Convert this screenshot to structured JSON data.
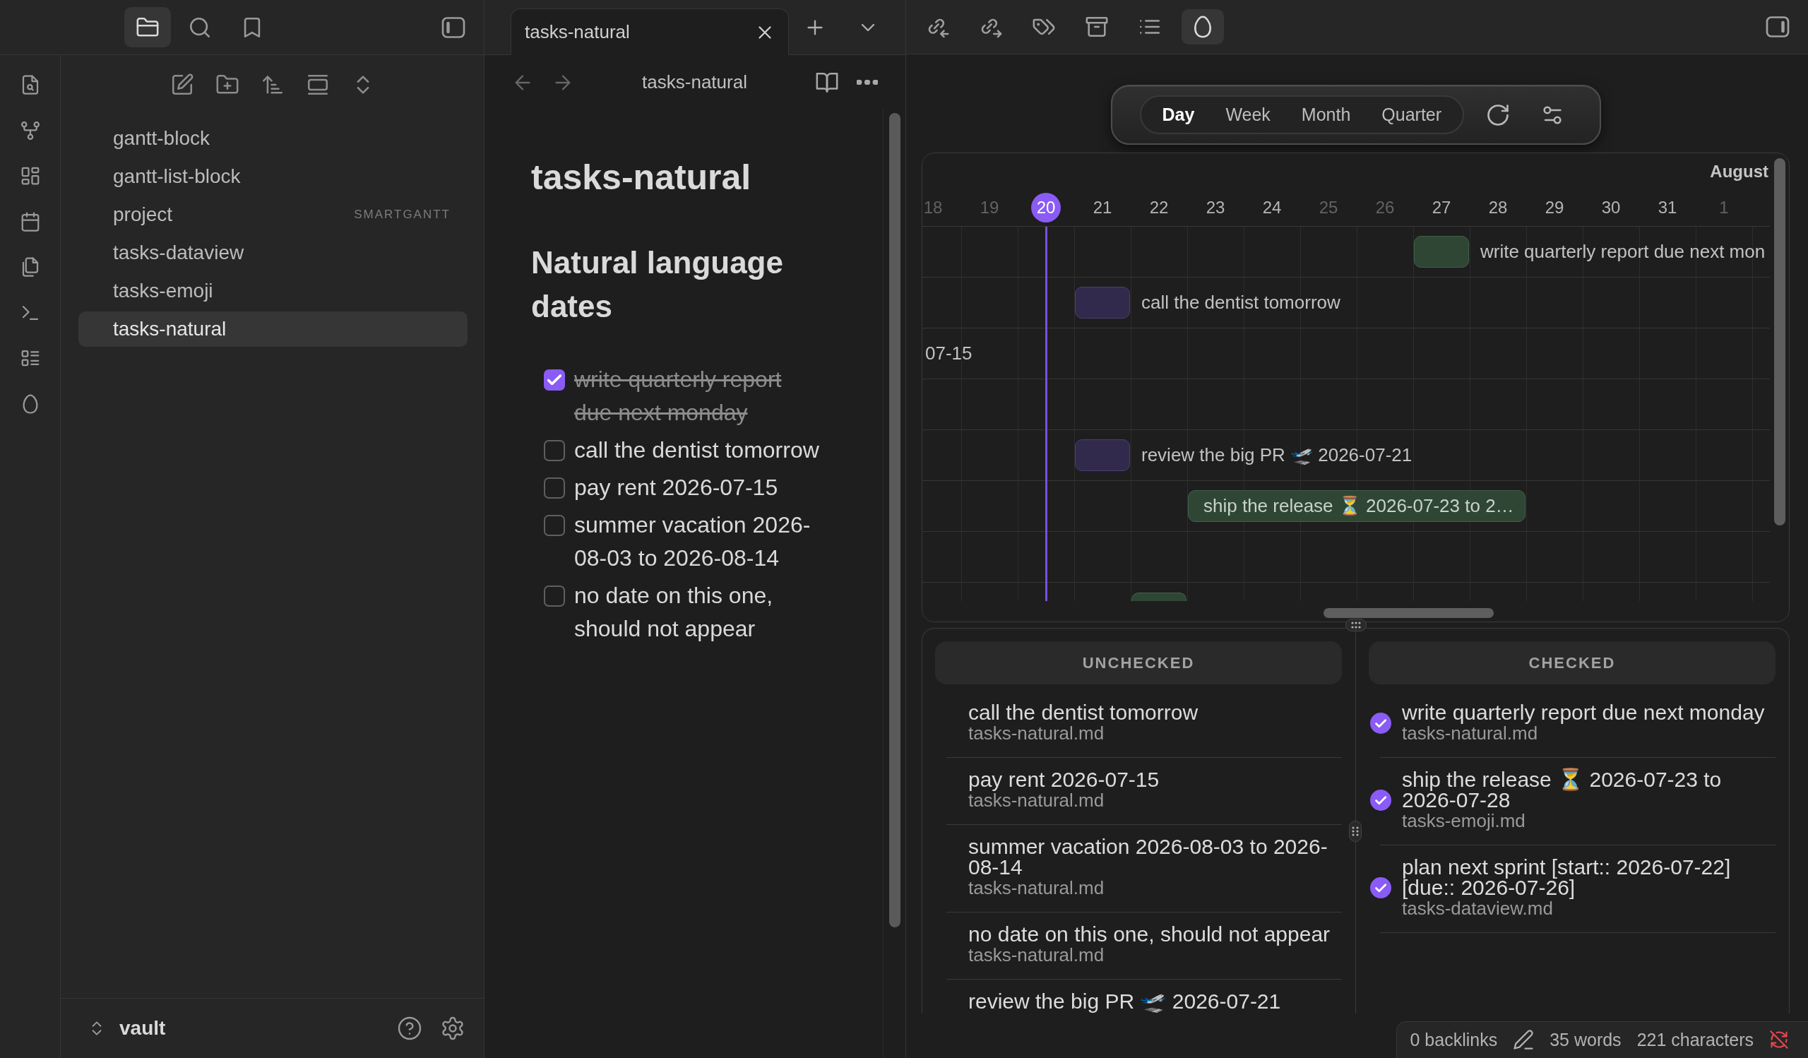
{
  "left_sidebar": {
    "tabs": [
      {
        "selected": true
      },
      {
        "selected": false
      },
      {
        "selected": false
      }
    ],
    "files": [
      {
        "name": "gantt-block",
        "selected": false
      },
      {
        "name": "gantt-list-block",
        "selected": false
      },
      {
        "name": "project",
        "tag": "SMARTGANTT",
        "selected": false
      },
      {
        "name": "tasks-dataview",
        "selected": false
      },
      {
        "name": "tasks-emoji",
        "selected": false
      },
      {
        "name": "tasks-natural",
        "selected": true
      }
    ],
    "vault": "vault"
  },
  "editor": {
    "tab_title": "tasks-natural",
    "view_title": "tasks-natural",
    "title": "tasks-natural",
    "heading": "Natural language dates",
    "tasks": [
      {
        "text": "write quarterly report due next monday",
        "checked": true
      },
      {
        "text": "call the dentist tomorrow",
        "checked": false
      },
      {
        "text": "pay rent 2026-07-15",
        "checked": false
      },
      {
        "text": "summer vacation 2026-08-03 to 2026-08-14",
        "checked": false
      },
      {
        "text": "no date on this one, should not appear",
        "checked": false
      }
    ]
  },
  "right_pane": {
    "toolbar": [
      {
        "selected": false
      },
      {
        "selected": false
      },
      {
        "selected": false
      },
      {
        "selected": false
      },
      {
        "selected": false
      },
      {
        "selected": true
      }
    ],
    "gantt": {
      "views": [
        {
          "label": "Day",
          "selected": true
        },
        {
          "label": "Week",
          "selected": false
        },
        {
          "label": "Month",
          "selected": false
        },
        {
          "label": "Quarter",
          "selected": false
        }
      ],
      "month": "August",
      "days": [
        {
          "label": "18",
          "weekend": true,
          "today": false
        },
        {
          "label": "19",
          "weekend": true,
          "today": false
        },
        {
          "label": "20",
          "weekend": false,
          "today": true
        },
        {
          "label": "21",
          "weekend": false,
          "today": false
        },
        {
          "label": "22",
          "weekend": false,
          "today": false
        },
        {
          "label": "23",
          "weekend": false,
          "today": false
        },
        {
          "label": "24",
          "weekend": false,
          "today": false
        },
        {
          "label": "25",
          "weekend": true,
          "today": false
        },
        {
          "label": "26",
          "weekend": true,
          "today": false
        },
        {
          "label": "27",
          "weekend": false,
          "today": false
        },
        {
          "label": "28",
          "weekend": false,
          "today": false
        },
        {
          "label": "29",
          "weekend": false,
          "today": false
        },
        {
          "label": "30",
          "weekend": false,
          "today": false
        },
        {
          "label": "31",
          "weekend": false,
          "today": false
        },
        {
          "label": "1",
          "weekend": true,
          "today": false
        }
      ],
      "rows": [
        {
          "kind": "bar",
          "label": "write quarterly report due next mon",
          "checked": true,
          "cells": [
            {
              "kind": "none"
            },
            {
              "kind": "none"
            },
            {
              "kind": "none"
            },
            {
              "kind": "none"
            },
            {
              "kind": "none"
            },
            {
              "kind": "none"
            },
            {
              "kind": "none"
            },
            {
              "kind": "none"
            },
            {
              "kind": "none"
            },
            {
              "kind": "bar"
            },
            {
              "kind": "none"
            },
            {
              "kind": "none"
            },
            {
              "kind": "none"
            },
            {
              "kind": "none"
            },
            {
              "kind": "none"
            }
          ]
        },
        {
          "kind": "bar",
          "label": "call the dentist tomorrow",
          "checked": false,
          "cells": [
            {
              "kind": "none"
            },
            {
              "kind": "none"
            },
            {
              "kind": "none"
            },
            {
              "kind": "bar"
            },
            {
              "kind": "none"
            },
            {
              "kind": "none"
            },
            {
              "kind": "none"
            },
            {
              "kind": "none"
            },
            {
              "kind": "none"
            },
            {
              "kind": "none"
            },
            {
              "kind": "none"
            },
            {
              "kind": "none"
            },
            {
              "kind": "none"
            },
            {
              "kind": "none"
            },
            {
              "kind": "none"
            }
          ]
        },
        {
          "kind": "label_only",
          "label": "07-15"
        },
        {
          "kind": "empty"
        },
        {
          "kind": "bar",
          "label": "review the big PR 🛫 2026-07-21",
          "checked": false,
          "cells": [
            {
              "kind": "none"
            },
            {
              "kind": "none"
            },
            {
              "kind": "none"
            },
            {
              "kind": "bar"
            },
            {
              "kind": "none"
            },
            {
              "kind": "none"
            },
            {
              "kind": "none"
            },
            {
              "kind": "none"
            },
            {
              "kind": "none"
            },
            {
              "kind": "none"
            },
            {
              "kind": "none"
            },
            {
              "kind": "none"
            },
            {
              "kind": "none"
            },
            {
              "kind": "none"
            },
            {
              "kind": "none"
            }
          ]
        },
        {
          "kind": "bar",
          "label": "ship the release ⏳ 2026-07-23 to 2…",
          "checked": true,
          "cells": [
            {
              "kind": "none"
            },
            {
              "kind": "none"
            },
            {
              "kind": "none"
            },
            {
              "kind": "none"
            },
            {
              "kind": "none"
            },
            {
              "kind": "bar"
            },
            {
              "kind": "bar"
            },
            {
              "kind": "bar"
            },
            {
              "kind": "bar"
            },
            {
              "kind": "bar"
            },
            {
              "kind": "bar"
            },
            {
              "kind": "none"
            },
            {
              "kind": "none"
            },
            {
              "kind": "none"
            },
            {
              "kind": "none"
            }
          ]
        },
        {
          "kind": "empty"
        },
        {
          "kind": "bar",
          "checked": true,
          "cells": [
            {
              "kind": "none"
            },
            {
              "kind": "none"
            },
            {
              "kind": "none"
            },
            {
              "kind": "none"
            },
            {
              "kind": "bar"
            },
            {
              "kind": "none"
            },
            {
              "kind": "none"
            },
            {
              "kind": "none"
            },
            {
              "kind": "none"
            },
            {
              "kind": "none"
            },
            {
              "kind": "none"
            },
            {
              "kind": "none"
            },
            {
              "kind": "none"
            },
            {
              "kind": "none"
            },
            {
              "kind": "none"
            }
          ]
        }
      ]
    },
    "lists": [
      {
        "title": "UNCHECKED",
        "items": [
          {
            "text": "call the dentist tomorrow",
            "file": "tasks-natural.md",
            "checked": false
          },
          {
            "text": "pay rent 2026-07-15",
            "file": "tasks-natural.md",
            "checked": false
          },
          {
            "text": "summer vacation 2026-08-03 to 2026-08-14",
            "file": "tasks-natural.md",
            "checked": false
          },
          {
            "text": "no date on this one, should not appear",
            "file": "tasks-natural.md",
            "checked": false
          },
          {
            "text": "review the big PR 🛫 2026-07-21",
            "checked": false
          }
        ]
      },
      {
        "title": "CHECKED",
        "items": [
          {
            "text": "write quarterly report due next monday",
            "file": "tasks-natural.md",
            "checked": true
          },
          {
            "text": "ship the release ⏳ 2026-07-23 to 2026-07-28",
            "file": "tasks-emoji.md",
            "checked": true
          },
          {
            "text": "plan next sprint [start:: 2026-07-22] [due:: 2026-07-26]",
            "file": "tasks-dataview.md",
            "checked": true
          }
        ]
      }
    ]
  },
  "status_bar": {
    "backlinks": "0 backlinks",
    "words": "35 words",
    "characters": "221 characters",
    "sync_error": true
  }
}
